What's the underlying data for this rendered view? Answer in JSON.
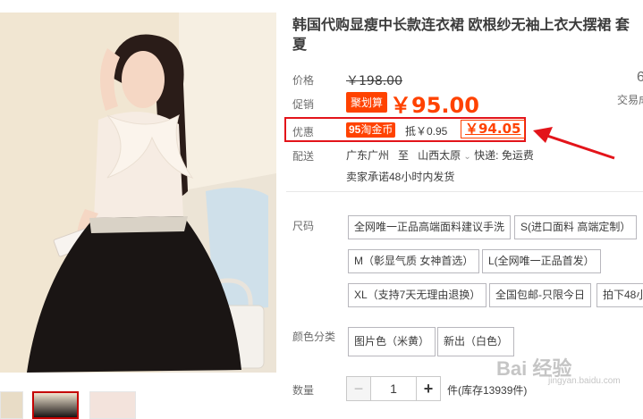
{
  "product": {
    "title_line1": "韩国代购显瘦中长款连衣裙 欧根纱无袖上衣大摆裙 套",
    "title_line2": "夏"
  },
  "price": {
    "label": "价格",
    "original": "￥198.00",
    "side_number": "6",
    "side_text": "交易成"
  },
  "promo": {
    "label": "促销",
    "badge": "聚划算",
    "price": "￥95.00"
  },
  "discount": {
    "label": "优惠",
    "coin_amount": "95",
    "coin_text": "淘金币",
    "deduct": "抵￥0.95",
    "final_price": "￥94.05"
  },
  "shipping": {
    "label": "配送",
    "from": "广东广州",
    "to_word": "至",
    "to": "山西太原",
    "method": "快递: 免运费",
    "promise": "卖家承诺48小时内发货"
  },
  "size": {
    "label": "尺码",
    "options": [
      "全网唯一正品高端面料建议手洗",
      "S(进口面料 高端定制）",
      "M（彰显气质 女神首选）",
      "L(全网唯一正品首发）",
      "XL（支持7天无理由退换）",
      "全国包邮-只限今日",
      "拍下48小"
    ]
  },
  "color": {
    "label": "颜色分类",
    "options": [
      "图片色（米黄）",
      "新出（白色）"
    ]
  },
  "quantity": {
    "label": "数量",
    "minus": "−",
    "value": "1",
    "plus": "+",
    "unit_stock": "件(库存13939件)"
  },
  "watermark": {
    "brand": "Bai 经验",
    "url": "jingyan.baidu.com"
  },
  "colors": {
    "accent": "#ff4200",
    "highlight_box": "#e3141a",
    "arrow": "#e3141a"
  }
}
